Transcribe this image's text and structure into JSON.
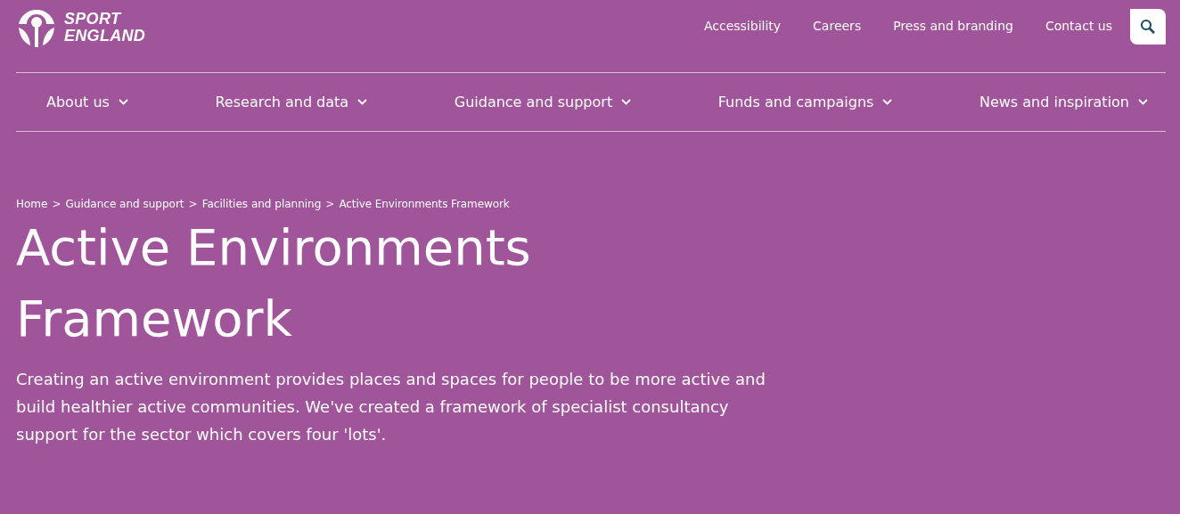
{
  "logo": {
    "lines": [
      "SPORT",
      "ENGLAND"
    ]
  },
  "utility_links": [
    "Accessibility",
    "Careers",
    "Press and branding",
    "Contact us"
  ],
  "main_nav": [
    {
      "label": "About us",
      "expanded": false
    },
    {
      "label": "Research and data",
      "expanded": false
    },
    {
      "label": "Guidance and support",
      "expanded": false
    },
    {
      "label": "Funds and campaigns",
      "expanded": false
    },
    {
      "label": "News and inspiration",
      "expanded": false
    }
  ],
  "breadcrumb": [
    {
      "kind": "link",
      "label": "Home"
    },
    {
      "kind": "separator",
      "label": ">"
    },
    {
      "kind": "link",
      "label": "Guidance and support"
    },
    {
      "kind": "separator",
      "label": ">"
    },
    {
      "kind": "link",
      "label": "Facilities and planning"
    },
    {
      "kind": "separator",
      "label": ">"
    },
    {
      "kind": "current",
      "label": "Active Environments Framework"
    }
  ],
  "title": "Active Environments Framework",
  "intro": "Creating an active environment provides places and spaces for people to be more active and build healthier active communities. We've created a framework of specialist consultancy support for the sector which covers four 'lots'."
}
